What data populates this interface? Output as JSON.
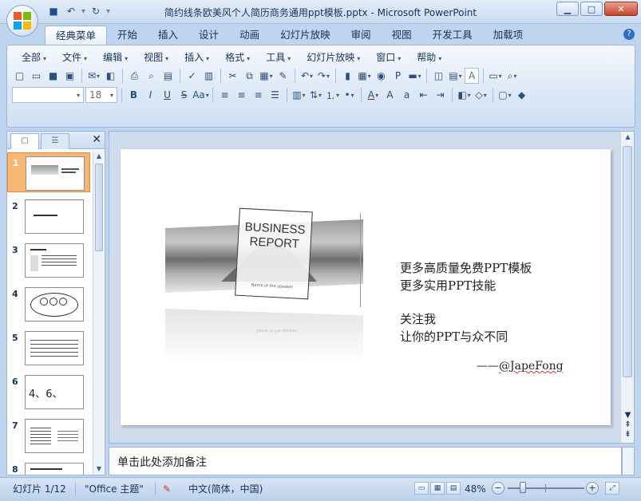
{
  "window": {
    "title": "简约线条欧美风个人简历商务通用ppt模板.pptx - Microsoft PowerPoint"
  },
  "quick_access": {
    "save": "💾",
    "undo": "↶",
    "redo": "↷"
  },
  "ribbon_tabs": [
    {
      "label": "经典菜单",
      "active": true
    },
    {
      "label": "开始"
    },
    {
      "label": "插入"
    },
    {
      "label": "设计"
    },
    {
      "label": "动画"
    },
    {
      "label": "幻灯片放映"
    },
    {
      "label": "审阅"
    },
    {
      "label": "视图"
    },
    {
      "label": "开发工具"
    },
    {
      "label": "加载项"
    }
  ],
  "classic_menu": [
    {
      "label": "全部"
    },
    {
      "label": "文件"
    },
    {
      "label": "编辑"
    },
    {
      "label": "视图"
    },
    {
      "label": "插入"
    },
    {
      "label": "格式"
    },
    {
      "label": "工具"
    },
    {
      "label": "幻灯片放映"
    },
    {
      "label": "窗口"
    },
    {
      "label": "帮助"
    }
  ],
  "toolbar": {
    "font_name": "",
    "font_size": "18",
    "zoom_combo": "A"
  },
  "thumbnails": [
    {
      "num": "1",
      "selected": true
    },
    {
      "num": "2"
    },
    {
      "num": "3"
    },
    {
      "num": "4"
    },
    {
      "num": "5"
    },
    {
      "num": "6",
      "text": "4、6、"
    },
    {
      "num": "7"
    },
    {
      "num": "8"
    }
  ],
  "slide": {
    "report_title_1": "BUSINESS",
    "report_title_2": "REPORT",
    "report_subtitle": "Name of the speaker",
    "line1": "更多高质量免费PPT模板",
    "line2": "更多实用PPT技能",
    "line3": "关注我",
    "line4": "让你的PPT与众不同",
    "signature_dash": "——",
    "signature_handle": "@JapeFong"
  },
  "notes": {
    "placeholder": "单击此处添加备注"
  },
  "status": {
    "slide_info": "幻灯片 1/12",
    "theme": "\"Office 主题\"",
    "language": "中文(简体，中国)",
    "zoom": "48%"
  }
}
